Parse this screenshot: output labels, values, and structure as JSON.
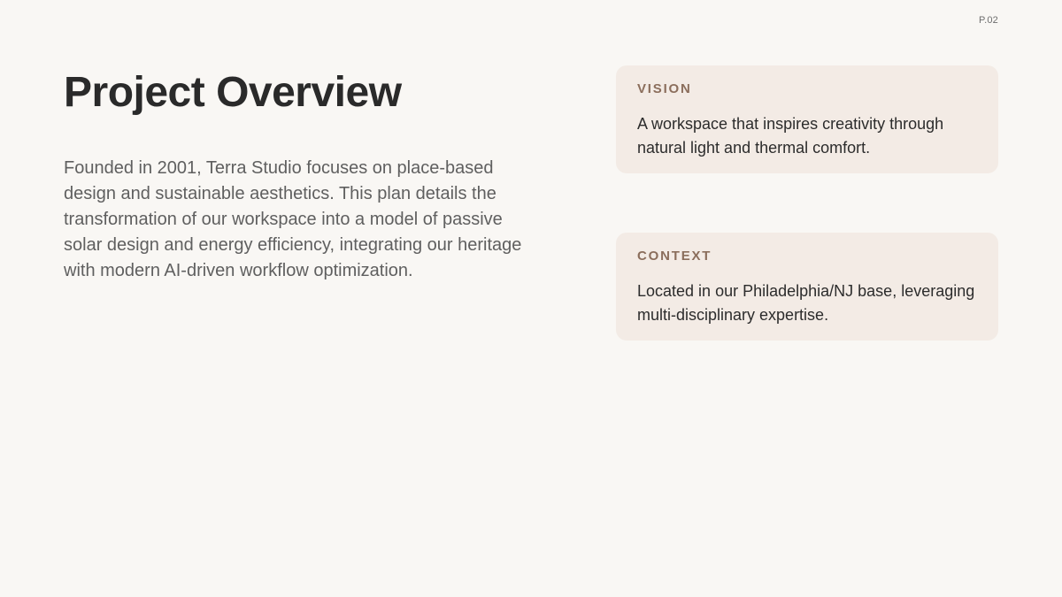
{
  "page": {
    "number": "P.02",
    "title": "Project Overview",
    "intro": "Founded in 2001, Terra Studio focuses on place-based design and sustainable aesthetics. This plan details the transformation of our workspace into a model of passive solar design and energy efficiency, integrating our heritage with modern AI-driven workflow optimization."
  },
  "cards": {
    "vision": {
      "label": "VISION",
      "text": "A workspace that inspires creativity through natural light and thermal comfort."
    },
    "context": {
      "label": "CONTEXT",
      "text": "Located in our Philadelphia/NJ base, leveraging multi-disciplinary expertise."
    }
  },
  "colors": {
    "background": "#f9f7f4",
    "card_background": "#f3ebe5",
    "label_accent": "#8b6e5c",
    "title_text": "#2a2a2a",
    "body_text": "#5f5f5f"
  }
}
